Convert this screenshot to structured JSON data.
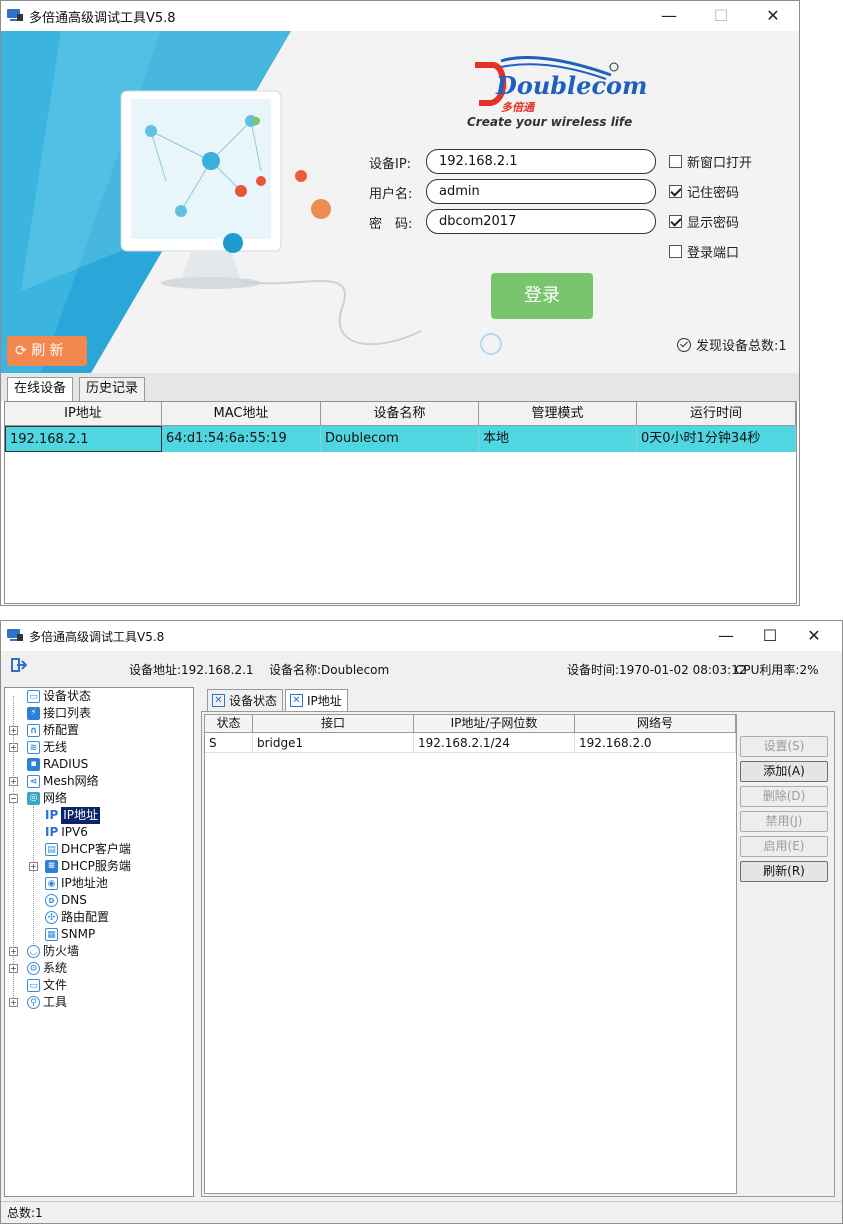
{
  "login_window": {
    "title": "多倍通高级调试工具V5.8",
    "controls": {
      "minimize": "—",
      "maximize": "☐",
      "close": "✕"
    },
    "logo_text": "Doublecom",
    "logo_cn": "多倍通",
    "slogan": "Create your wireless life",
    "form": {
      "ip_label": "设备IP:",
      "ip_value": "192.168.2.1",
      "user_label": "用户名:",
      "user_value": "admin",
      "pass_label": "密　码:",
      "pass_value": "dbcom2017"
    },
    "options": [
      {
        "label": "新窗口打开",
        "checked": false
      },
      {
        "label": "记住密码",
        "checked": true
      },
      {
        "label": "显示密码",
        "checked": true
      },
      {
        "label": "登录端口",
        "checked": false
      }
    ],
    "login_button": "登录",
    "refresh_button": "刷 新",
    "found_text": "发现设备总数:1",
    "tabs": [
      "在线设备",
      "历史记录"
    ],
    "table": {
      "headers": [
        "IP地址",
        "MAC地址",
        "设备名称",
        "管理模式",
        "运行时间"
      ],
      "rows": [
        [
          "192.168.2.1",
          "64:d1:54:6a:55:19",
          "Doublecom",
          "本地",
          "0天0小时1分钟34秒"
        ]
      ]
    },
    "colors": {
      "login_btn": "#79c56d",
      "refresh_btn": "#f2884e",
      "row_highlight": "#4fd6e1"
    }
  },
  "main_window": {
    "title": "多倍通高级调试工具V5.8",
    "controls": {
      "minimize": "—",
      "maximize": "☐",
      "close": "✕"
    },
    "info": {
      "device_addr": "设备地址:192.168.2.1",
      "device_name": "设备名称:Doublecom",
      "device_time": "设备时间:1970-01-02 08:03:12",
      "cpu": "CPU利用率:2%"
    },
    "tree": [
      {
        "label": "设备状态",
        "icon": "monitor-icon"
      },
      {
        "label": "接口列表",
        "icon": "plug-icon"
      },
      {
        "label": "桥配置",
        "icon": "bridge-icon"
      },
      {
        "label": "无线",
        "icon": "wifi-icon"
      },
      {
        "label": "RADIUS",
        "icon": "radius-icon"
      },
      {
        "label": "Mesh网络",
        "icon": "mesh-icon"
      },
      {
        "label": "网络",
        "icon": "globe-icon"
      },
      {
        "label": "IP地址",
        "prefix": "IP",
        "selected": true
      },
      {
        "label": "IPV6",
        "prefix": "IP"
      },
      {
        "label": "DHCP客户端",
        "icon": "dhcp-client-icon"
      },
      {
        "label": "DHCP服务端",
        "icon": "dhcp-server-icon"
      },
      {
        "label": "IP地址池",
        "icon": "pool-icon"
      },
      {
        "label": "DNS",
        "icon": "dns-icon"
      },
      {
        "label": "路由配置",
        "icon": "route-icon"
      },
      {
        "label": "SNMP",
        "icon": "snmp-icon"
      },
      {
        "label": "防火墙",
        "icon": "firewall-icon"
      },
      {
        "label": "系统",
        "icon": "gear-icon"
      },
      {
        "label": "文件",
        "icon": "folder-icon"
      },
      {
        "label": "工具",
        "icon": "tool-icon"
      }
    ],
    "tabs": [
      "设备状态",
      "IP地址"
    ],
    "table": {
      "headers": [
        "状态",
        "接口",
        "IP地址/子网位数",
        "网络号"
      ],
      "rows": [
        [
          "S",
          "bridge1",
          "192.168.2.1/24",
          "192.168.2.0"
        ]
      ]
    },
    "buttons": [
      {
        "label": "设置(S)",
        "enabled": false
      },
      {
        "label": "添加(A)",
        "enabled": true
      },
      {
        "label": "删除(D)",
        "enabled": false
      },
      {
        "label": "禁用(J)",
        "enabled": false
      },
      {
        "label": "启用(E)",
        "enabled": false
      },
      {
        "label": "刷新(R)",
        "enabled": true
      }
    ],
    "status": "总数:1"
  }
}
